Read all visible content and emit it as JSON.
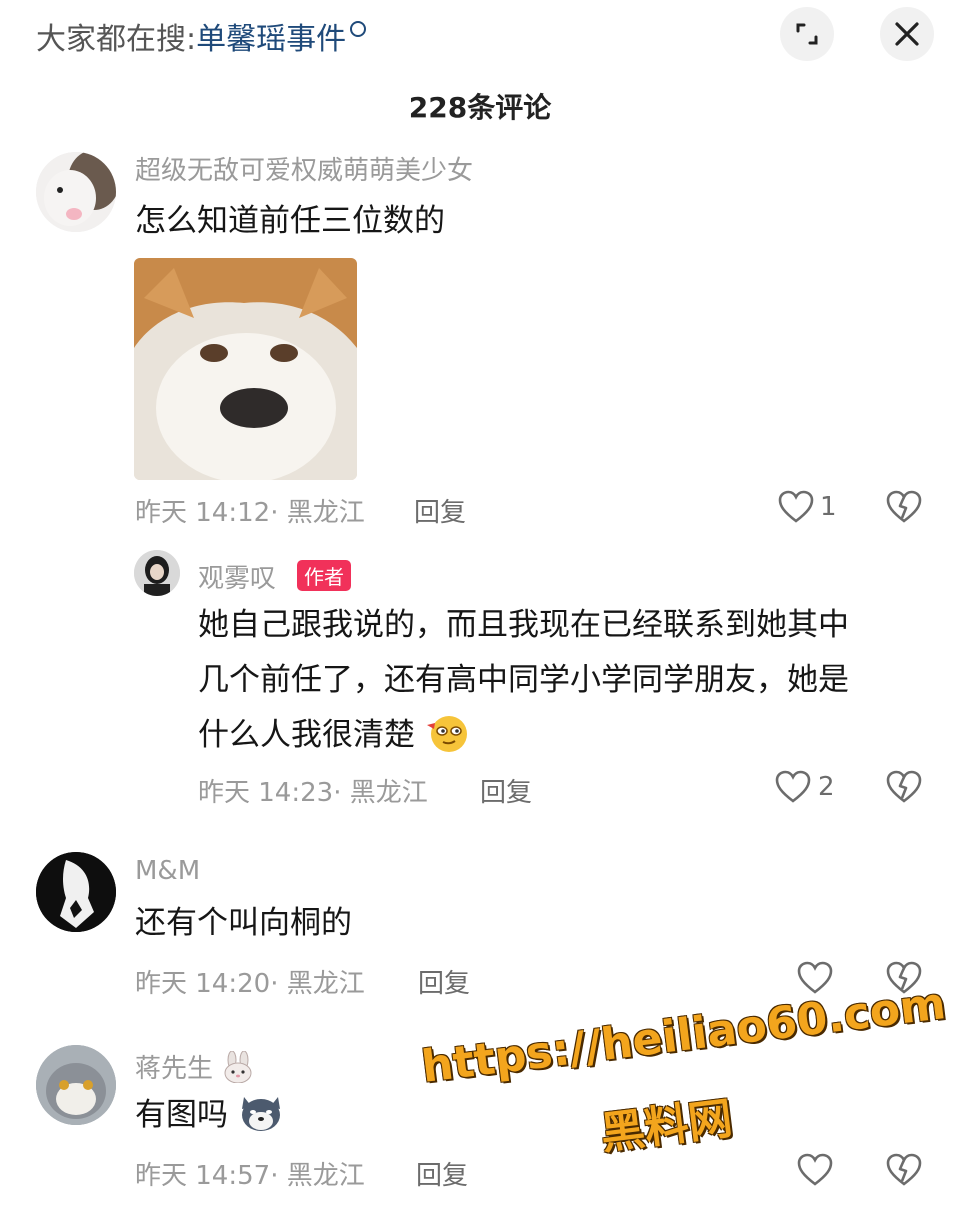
{
  "search": {
    "prefix": "大家都在搜:",
    "query": "单馨瑶事件"
  },
  "comments_header": {
    "count_label": "228条评论"
  },
  "comments": [
    {
      "username": "超级无敌可爱权威萌萌美少女",
      "text": "怎么知道前任三位数的",
      "meta": "昨天 14:12· 黑龙江",
      "reply_label": "回复",
      "likes": "1"
    },
    {
      "username": "M&M",
      "text": "还有个叫向桐的",
      "meta": "昨天 14:20· 黑龙江",
      "reply_label": "回复"
    },
    {
      "username": "蒋先生",
      "text": "有图吗",
      "meta": "昨天 14:57· 黑龙江",
      "reply_label": "回复"
    }
  ],
  "reply": {
    "username": "观雾叹",
    "badge": "作者",
    "lines": [
      "她自己跟我说的，而且我现在已经联系到她其中",
      "几个前任了，还有高中同学小学同学朋友，她是",
      "什么人我很清楚"
    ],
    "meta": "昨天 14:23· 黑龙江",
    "reply_label": "回复",
    "likes": "2"
  },
  "watermark": {
    "url": "https://heiliao60.com",
    "name": "黑料网"
  },
  "colors": {
    "link": "#1f4a7a",
    "badge": "#f1315a",
    "watermark": "#f3a51d"
  }
}
